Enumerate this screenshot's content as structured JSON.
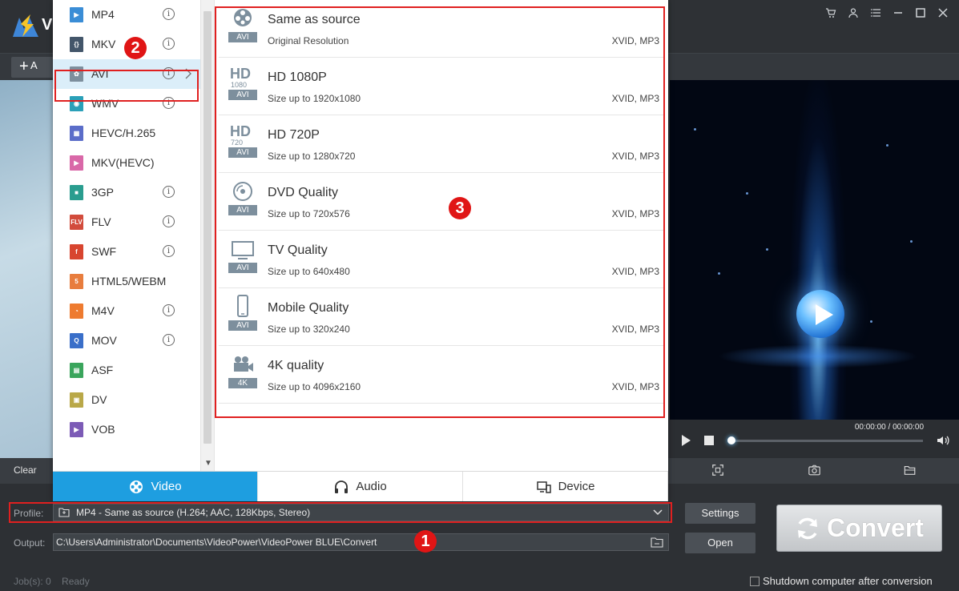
{
  "app": {
    "logo_letter": "V"
  },
  "toolbar": {
    "add_label": "A"
  },
  "formats": [
    {
      "label": "MP4",
      "icon": "mp4-icon",
      "color": "#3a8dd6",
      "glyph": "▶",
      "info": true,
      "selected": false
    },
    {
      "label": "MKV",
      "icon": "mkv-icon",
      "color": "#43566a",
      "glyph": "{}",
      "info": true,
      "selected": false
    },
    {
      "label": "AVI",
      "icon": "avi-icon",
      "color": "#7d8f9d",
      "glyph": "✿",
      "info": true,
      "selected": true
    },
    {
      "label": "WMV",
      "icon": "wmv-icon",
      "color": "#2aa0b8",
      "glyph": "◉",
      "info": true,
      "selected": false
    },
    {
      "label": "HEVC/H.265",
      "icon": "hevc-icon",
      "color": "#5b6dc9",
      "glyph": "▦",
      "info": false,
      "selected": false
    },
    {
      "label": "MKV(HEVC)",
      "icon": "mkv-hevc-icon",
      "color": "#d968a8",
      "glyph": "▶",
      "info": false,
      "selected": false
    },
    {
      "label": "3GP",
      "icon": "3gp-icon",
      "color": "#2a9d8f",
      "glyph": "■",
      "info": true,
      "selected": false
    },
    {
      "label": "FLV",
      "icon": "flv-icon",
      "color": "#d24c3c",
      "glyph": "FLV",
      "info": true,
      "selected": false
    },
    {
      "label": "SWF",
      "icon": "swf-icon",
      "color": "#d8452f",
      "glyph": "f",
      "info": true,
      "selected": false
    },
    {
      "label": "HTML5/WEBM",
      "icon": "html5-icon",
      "color": "#e87d3e",
      "glyph": "5",
      "info": false,
      "selected": false
    },
    {
      "label": "M4V",
      "icon": "m4v-icon",
      "color": "#ee7b30",
      "glyph": "◔",
      "info": true,
      "selected": false
    },
    {
      "label": "MOV",
      "icon": "mov-icon",
      "color": "#3a6fc9",
      "glyph": "Q",
      "info": true,
      "selected": false
    },
    {
      "label": "ASF",
      "icon": "asf-icon",
      "color": "#3aa55c",
      "glyph": "▤",
      "info": false,
      "selected": false
    },
    {
      "label": "DV",
      "icon": "dv-icon",
      "color": "#b9a848",
      "glyph": "▣",
      "info": false,
      "selected": false
    },
    {
      "label": "VOB",
      "icon": "vob-icon",
      "color": "#7c5bb6",
      "glyph": "▶",
      "info": false,
      "selected": false
    }
  ],
  "options": [
    {
      "title": "Same as source",
      "subtitle": "Original Resolution",
      "codec": "XVID, MP3",
      "badge": "AVI",
      "icon": "film-reel-icon"
    },
    {
      "title": "HD 1080P",
      "subtitle": "Size up to 1920x1080",
      "codec": "XVID, MP3",
      "badge": "AVI",
      "icon": "hd-1080-icon",
      "icon_top": "HD",
      "icon_mid": "1080"
    },
    {
      "title": "HD 720P",
      "subtitle": "Size up to 1280x720",
      "codec": "XVID, MP3",
      "badge": "AVI",
      "icon": "hd-720-icon",
      "icon_top": "HD",
      "icon_mid": "720"
    },
    {
      "title": "DVD Quality",
      "subtitle": "Size up to 720x576",
      "codec": "XVID, MP3",
      "badge": "AVI",
      "icon": "dvd-icon"
    },
    {
      "title": "TV Quality",
      "subtitle": "Size up to 640x480",
      "codec": "XVID, MP3",
      "badge": "AVI",
      "icon": "tv-icon"
    },
    {
      "title": "Mobile Quality",
      "subtitle": "Size up to 320x240",
      "codec": "XVID, MP3",
      "badge": "AVI",
      "icon": "mobile-icon"
    },
    {
      "title": "4K quality",
      "subtitle": "Size up to 4096x2160",
      "codec": "XVID, MP3",
      "badge": "4K",
      "icon": "camera-4k-icon"
    }
  ],
  "tabs": [
    {
      "label": "Video",
      "active": true,
      "icon": "film-reel-icon"
    },
    {
      "label": "Audio",
      "active": false,
      "icon": "headphones-icon"
    },
    {
      "label": "Device",
      "active": false,
      "icon": "device-icon"
    }
  ],
  "steps": {
    "one": "1",
    "two": "2",
    "three": "3"
  },
  "profile": {
    "label": "Profile:",
    "value": "MP4 - Same as source (H.264; AAC, 128Kbps, Stereo)"
  },
  "output": {
    "label": "Output:",
    "value": "C:\\Users\\Administrator\\Documents\\VideoPower\\VideoPower BLUE\\Convert"
  },
  "buttons": {
    "settings": "Settings",
    "open": "Open",
    "convert": "Convert"
  },
  "player": {
    "time": "00:00:00 / 00:00:00",
    "progress": 0
  },
  "strip": {
    "clear": "Clear"
  },
  "status": {
    "jobs": "Job(s): 0",
    "state": "Ready"
  },
  "shutdown": {
    "label": "Shutdown computer after conversion",
    "checked": false
  },
  "colors": {
    "accent": "#1e9ee0",
    "highlight": "#e02020",
    "selected_row": "#dbeef9"
  }
}
